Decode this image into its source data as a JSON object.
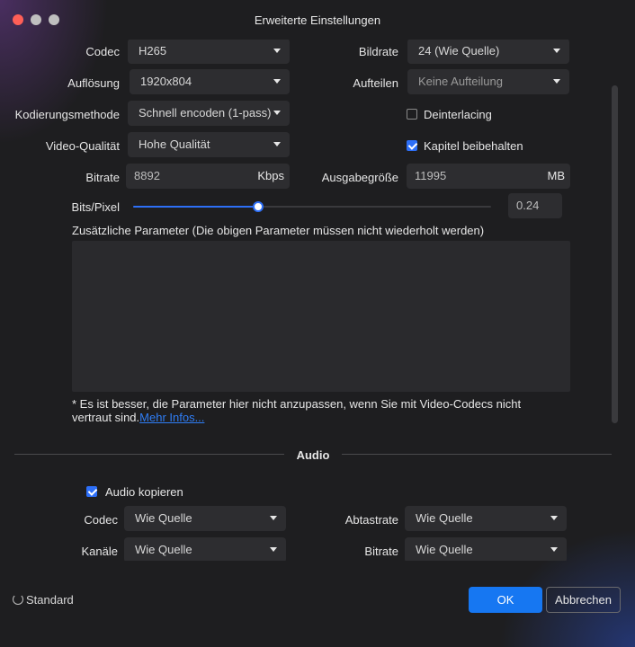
{
  "window": {
    "title": "Erweiterte Einstellungen"
  },
  "video": {
    "codec": {
      "label": "Codec",
      "value": "H265"
    },
    "resolution": {
      "label": "Auflösung",
      "value": "1920x804"
    },
    "encoding_method": {
      "label": "Kodierungsmethode",
      "value": "Schnell encoden (1-pass)"
    },
    "video_quality": {
      "label": "Video-Qualität",
      "value": "Hohe Qualität"
    },
    "bitrate": {
      "label": "Bitrate",
      "value": "8892",
      "unit": "Kbps"
    },
    "framerate": {
      "label": "Bildrate",
      "value": "24 (Wie Quelle)"
    },
    "split": {
      "label": "Aufteilen",
      "value": "Keine Aufteilung"
    },
    "deinterlacing": {
      "label": "Deinterlacing",
      "checked": false
    },
    "keep_chapters": {
      "label": "Kapitel beibehalten",
      "checked": true
    },
    "output_size": {
      "label": "Ausgabegröße",
      "value": "11995",
      "unit": "MB"
    },
    "bits_per_pixel": {
      "label": "Bits/Pixel",
      "value": "0.24",
      "slider_fraction": 0.35
    },
    "extra_params": {
      "label": "Zusätzliche Parameter (Die obigen Parameter müssen nicht wiederholt werden)",
      "value": ""
    },
    "note": {
      "text": "* Es ist besser, die Parameter hier nicht anzupassen, wenn Sie mit Video-Codecs nicht vertraut sind.",
      "link": "Mehr Infos..."
    }
  },
  "audio": {
    "section_title": "Audio",
    "copy_audio": {
      "label": "Audio kopieren",
      "checked": true
    },
    "codec": {
      "label": "Codec",
      "value": "Wie Quelle"
    },
    "sample_rate": {
      "label": "Abtastrate",
      "value": "Wie Quelle"
    },
    "channels": {
      "label": "Kanäle",
      "value": "Wie Quelle"
    },
    "bitrate": {
      "label": "Bitrate",
      "value": "Wie Quelle"
    }
  },
  "footer": {
    "standard_label": "Standard",
    "ok_label": "OK",
    "cancel_label": "Abbrechen"
  },
  "colors": {
    "accent": "#1677f2",
    "window_bg": "#1e1e20",
    "field_bg": "#2d2d30",
    "link": "#2f7df5"
  }
}
